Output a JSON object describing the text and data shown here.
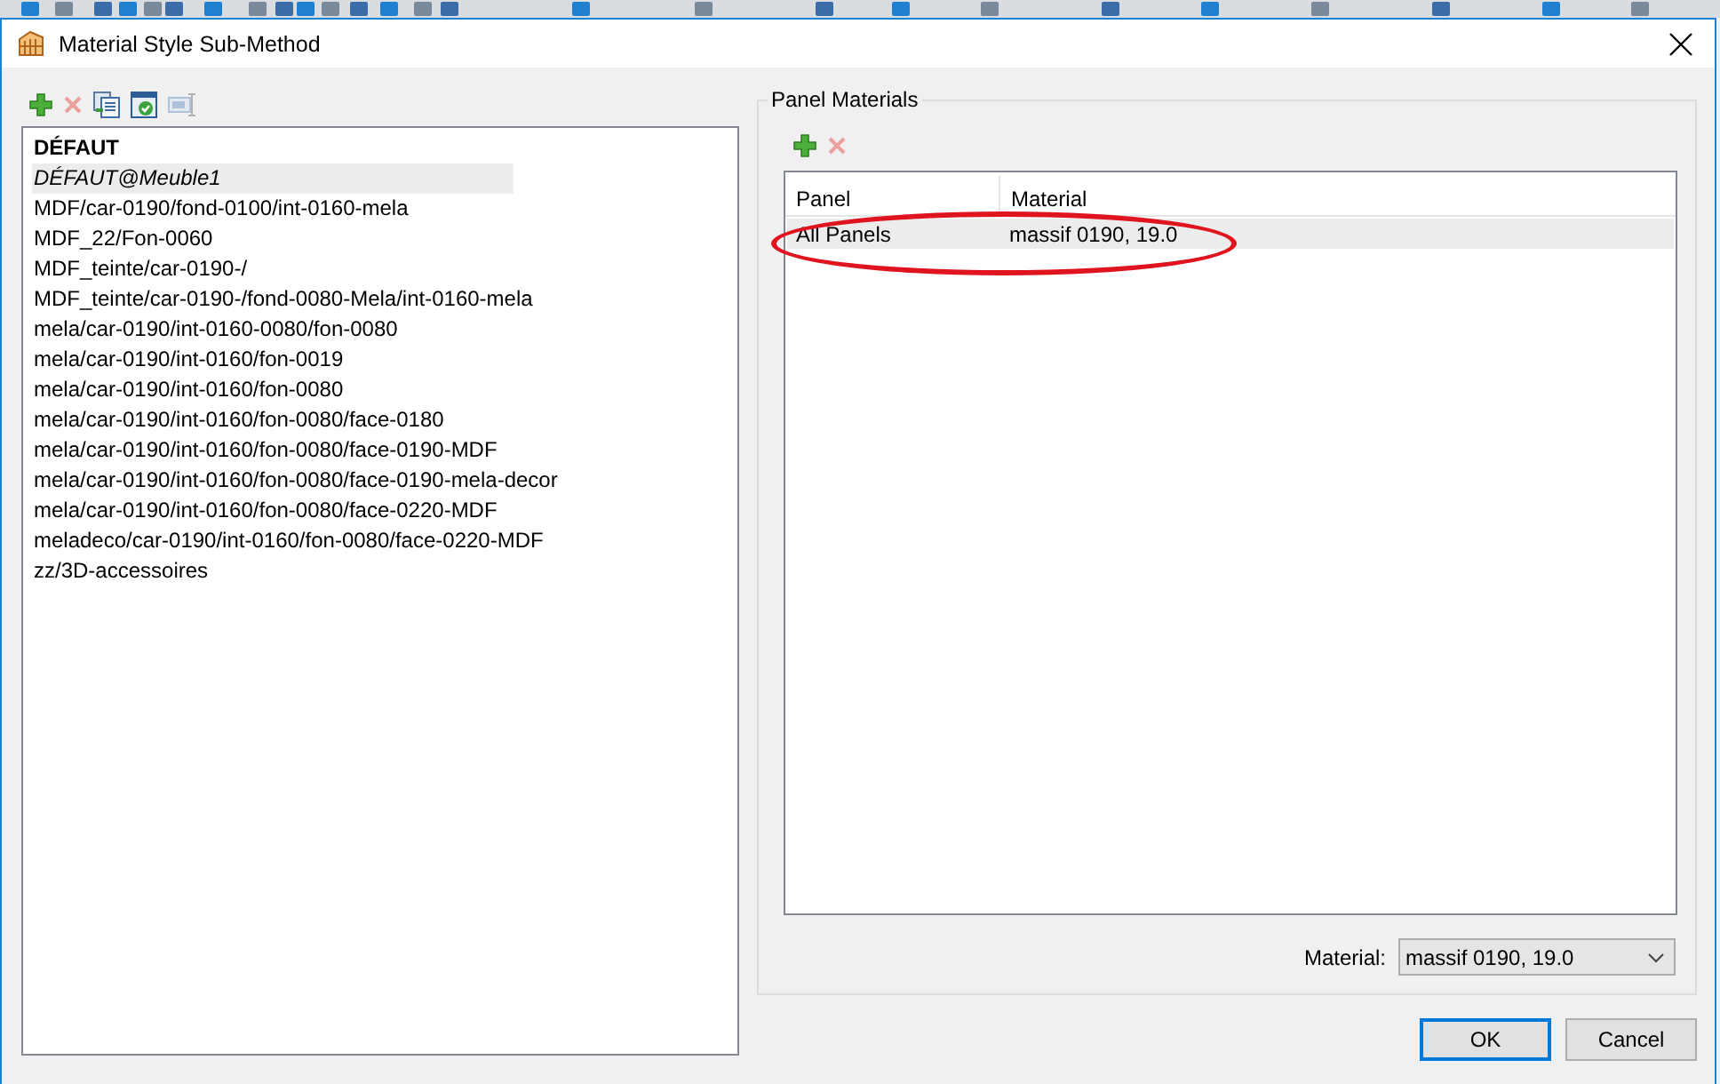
{
  "window": {
    "title": "Material Style Sub-Method"
  },
  "style_toolbar": [
    {
      "kind": "add",
      "disabled": false
    },
    {
      "kind": "delete",
      "disabled": true
    },
    {
      "kind": "copy",
      "disabled": false
    },
    {
      "kind": "apply",
      "disabled": false
    },
    {
      "kind": "rename",
      "disabled": true
    }
  ],
  "styles": [
    {
      "label": "DÉFAUT",
      "kind": "bold",
      "selected": false
    },
    {
      "label": "DÉFAUT@Meuble1",
      "kind": "italic",
      "selected": true
    },
    {
      "label": "MDF/car-0190/fond-0100/int-0160-mela",
      "kind": "plain",
      "selected": false
    },
    {
      "label": "MDF_22/Fon-0060",
      "kind": "plain",
      "selected": false
    },
    {
      "label": "MDF_teinte/car-0190-/",
      "kind": "plain",
      "selected": false
    },
    {
      "label": "MDF_teinte/car-0190-/fond-0080-Mela/int-0160-mela",
      "kind": "plain",
      "selected": false
    },
    {
      "label": "mela/car-0190/int-0160-0080/fon-0080",
      "kind": "plain",
      "selected": false
    },
    {
      "label": "mela/car-0190/int-0160/fon-0019",
      "kind": "plain",
      "selected": false
    },
    {
      "label": "mela/car-0190/int-0160/fon-0080",
      "kind": "plain",
      "selected": false
    },
    {
      "label": "mela/car-0190/int-0160/fon-0080/face-0180",
      "kind": "plain",
      "selected": false
    },
    {
      "label": "mela/car-0190/int-0160/fon-0080/face-0190-MDF",
      "kind": "plain",
      "selected": false
    },
    {
      "label": "mela/car-0190/int-0160/fon-0080/face-0190-mela-decor",
      "kind": "plain",
      "selected": false
    },
    {
      "label": "mela/car-0190/int-0160/fon-0080/face-0220-MDF",
      "kind": "plain",
      "selected": false
    },
    {
      "label": "meladeco/car-0190/int-0160/fon-0080/face-0220-MDF",
      "kind": "plain",
      "selected": false
    },
    {
      "label": "zz/3D-accessoires",
      "kind": "plain",
      "selected": false
    }
  ],
  "panel_materials": {
    "title": "Panel Materials",
    "toolbar": [
      {
        "kind": "add",
        "disabled": false
      },
      {
        "kind": "delete",
        "disabled": true
      }
    ],
    "columns": [
      "Panel",
      "Material"
    ],
    "rows": [
      {
        "cells": [
          "All Panels",
          "massif 0190, 19.0"
        ],
        "selected": true
      }
    ],
    "material_label": "Material:",
    "material_value": "massif 0190, 19.0"
  },
  "annotation": {
    "kind": "ellipse"
  },
  "buttons": [
    {
      "label": "OK",
      "default": true
    },
    {
      "label": "Cancel",
      "default": false
    }
  ]
}
